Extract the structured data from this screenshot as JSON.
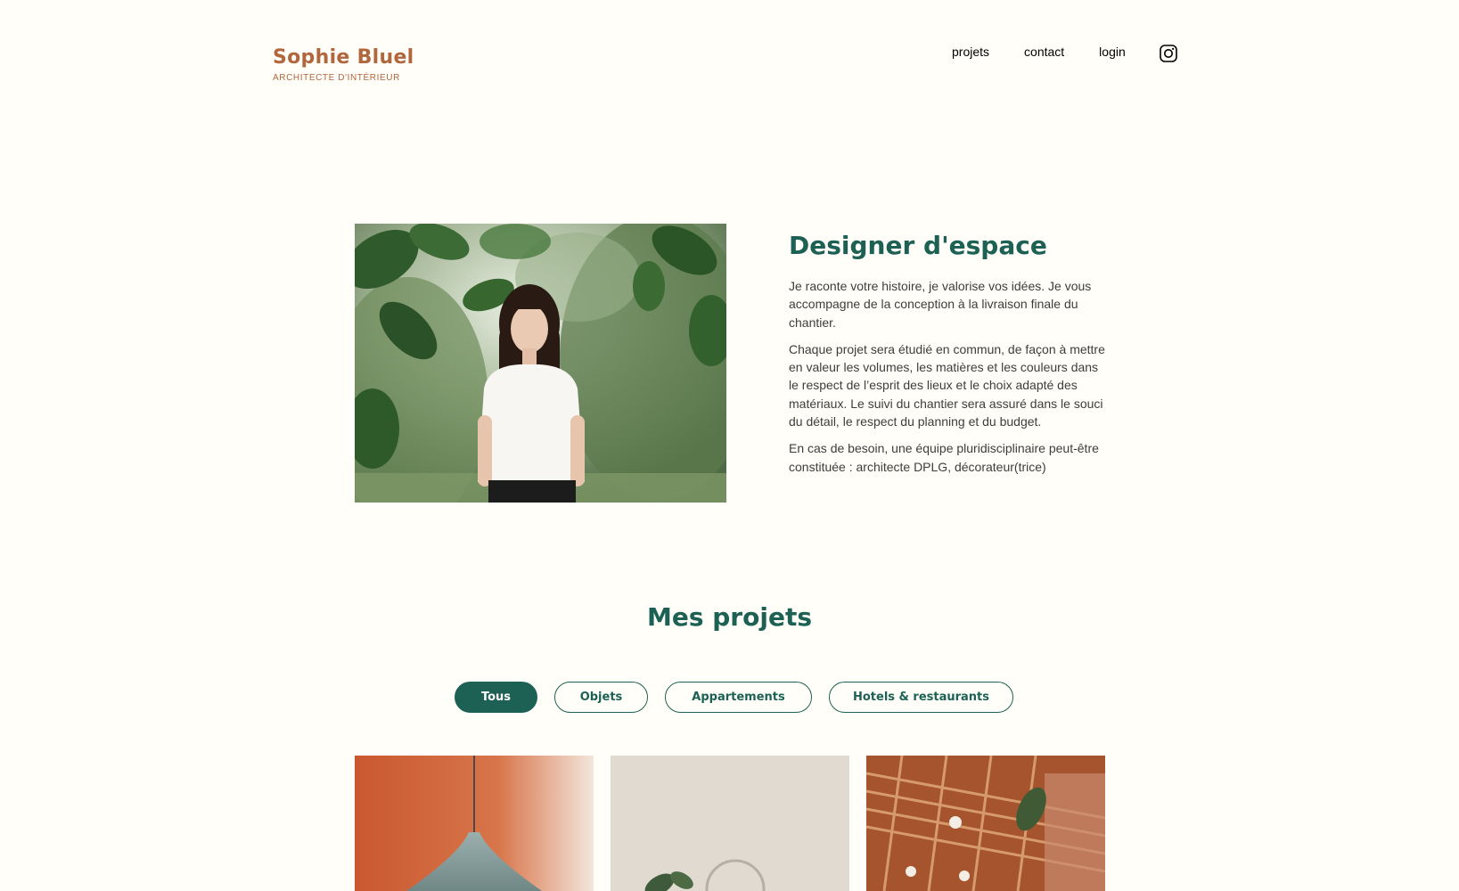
{
  "header": {
    "logo_title": "Sophie Bluel",
    "logo_subtitle": "ARCHITECTE D'INTÉRIEUR",
    "nav": {
      "projets": "projets",
      "contact": "contact",
      "login": "login"
    },
    "instagram_icon": "instagram-icon"
  },
  "intro": {
    "title": "Designer d'espace",
    "paragraphs": [
      "Je raconte votre histoire, je valorise vos idées. Je vous accompagne de la conception à la livraison finale du chantier.",
      "Chaque projet sera étudié en commun, de façon à mettre en valeur les volumes, les matières et les couleurs dans le respect de l’esprit des lieux et le choix adapté des matériaux. Le suivi du chantier sera assuré dans le souci du détail, le respect du planning et du budget.",
      "En cas de besoin, une équipe pluridisciplinaire peut-être constituée : architecte DPLG, décorateur(trice)"
    ]
  },
  "projects": {
    "title": "Mes projets",
    "filters": [
      {
        "label": "Tous",
        "active": true
      },
      {
        "label": "Objets",
        "active": false
      },
      {
        "label": "Appartements",
        "active": false
      },
      {
        "label": "Hotels & restaurants",
        "active": false
      }
    ]
  },
  "colors": {
    "background": "#FFFEF8",
    "brand": "#B1663C",
    "accent": "#1D6154",
    "text": "#3D3D3D"
  }
}
